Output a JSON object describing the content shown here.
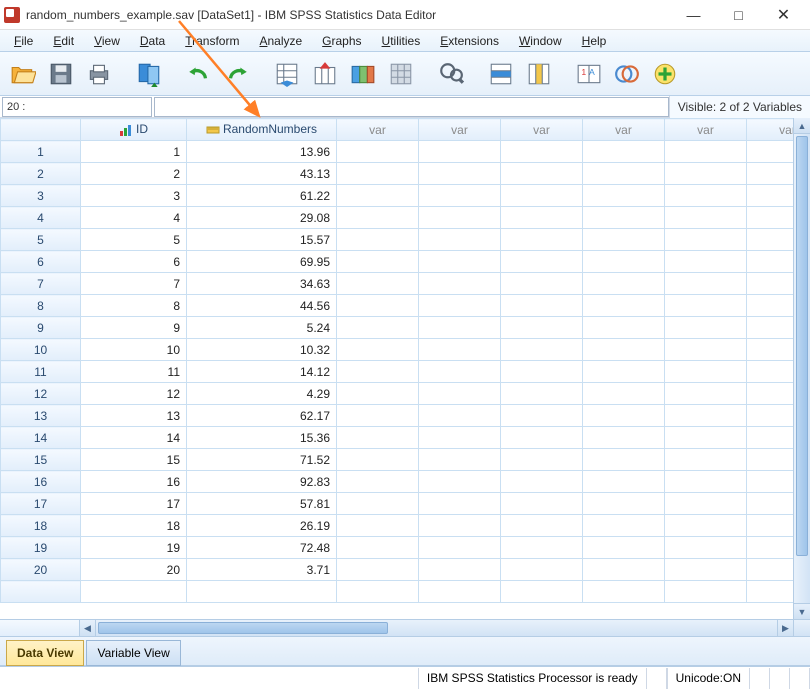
{
  "title": "random_numbers_example.sav [DataSet1] - IBM SPSS Statistics Data Editor",
  "menu": [
    "File",
    "Edit",
    "View",
    "Data",
    "Transform",
    "Analyze",
    "Graphs",
    "Utilities",
    "Extensions",
    "Window",
    "Help"
  ],
  "cell_ref": "20 :",
  "visible_text": "Visible: 2 of 2 Variables",
  "columns": {
    "id": "ID",
    "rand": "RandomNumbers",
    "var": "var"
  },
  "rows": [
    {
      "n": 1,
      "id": 1,
      "v": "13.96"
    },
    {
      "n": 2,
      "id": 2,
      "v": "43.13"
    },
    {
      "n": 3,
      "id": 3,
      "v": "61.22"
    },
    {
      "n": 4,
      "id": 4,
      "v": "29.08"
    },
    {
      "n": 5,
      "id": 5,
      "v": "15.57"
    },
    {
      "n": 6,
      "id": 6,
      "v": "69.95"
    },
    {
      "n": 7,
      "id": 7,
      "v": "34.63"
    },
    {
      "n": 8,
      "id": 8,
      "v": "44.56"
    },
    {
      "n": 9,
      "id": 9,
      "v": "5.24"
    },
    {
      "n": 10,
      "id": 10,
      "v": "10.32"
    },
    {
      "n": 11,
      "id": 11,
      "v": "14.12"
    },
    {
      "n": 12,
      "id": 12,
      "v": "4.29"
    },
    {
      "n": 13,
      "id": 13,
      "v": "62.17"
    },
    {
      "n": 14,
      "id": 14,
      "v": "15.36"
    },
    {
      "n": 15,
      "id": 15,
      "v": "71.52"
    },
    {
      "n": 16,
      "id": 16,
      "v": "92.83"
    },
    {
      "n": 17,
      "id": 17,
      "v": "57.81"
    },
    {
      "n": 18,
      "id": 18,
      "v": "26.19"
    },
    {
      "n": 19,
      "id": 19,
      "v": "72.48"
    },
    {
      "n": 20,
      "id": 20,
      "v": "3.71"
    }
  ],
  "tabs": {
    "data": "Data View",
    "var": "Variable View"
  },
  "status": {
    "proc": "IBM SPSS Statistics Processor is ready",
    "unicode": "Unicode:ON"
  },
  "toolbar_icons": [
    "open",
    "save",
    "print",
    "recall",
    "goto",
    "undo",
    "redo",
    "chart1",
    "chart2",
    "chart3",
    "grid1",
    "find",
    "insert-col",
    "grid2",
    "var-label",
    "weight",
    "add"
  ]
}
